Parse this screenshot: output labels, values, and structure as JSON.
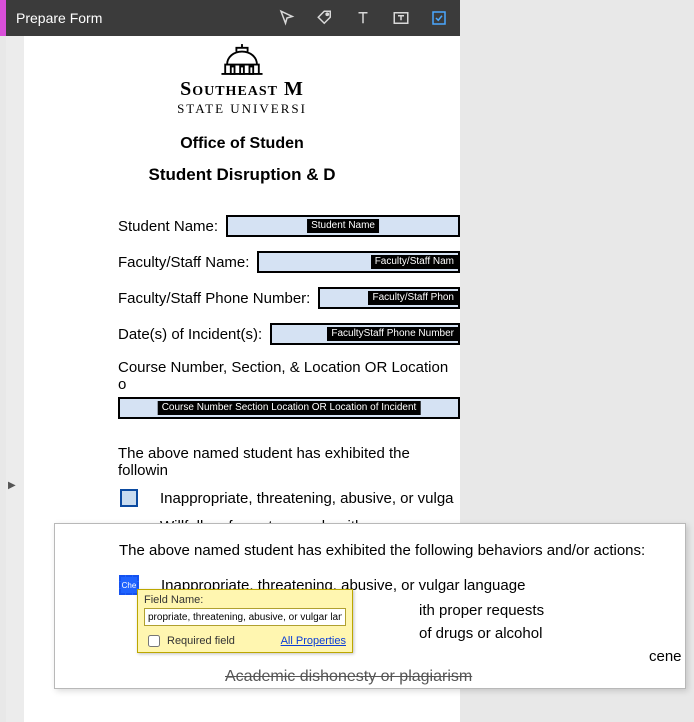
{
  "toolbar": {
    "title": "Prepare Form",
    "tools": {
      "pointer": "pointer-tool-icon",
      "tag": "tag-tool-icon",
      "text": "text-field-tool-icon",
      "textframe": "text-frame-tool-icon",
      "checkbox": "checkbox-tool-icon"
    }
  },
  "document": {
    "university_name": "Southeast M",
    "university_sub": "STATE UNIVERSI",
    "office_line": "Office of Studen",
    "form_title": "Student Disruption & D",
    "fields": {
      "student_name": {
        "label": "Student Name:",
        "tag": "Student Name"
      },
      "faculty_name": {
        "label": "Faculty/Staff Name:",
        "tag": "Faculty/Staff Nam"
      },
      "faculty_phone": {
        "label": "Faculty/Staff Phone Number:",
        "tag": "Faculty/Staff Phon"
      },
      "dates": {
        "label": "Date(s) of Incident(s):",
        "tag": "FacultyStaff Phone Number"
      },
      "course_loc": {
        "label": "Course Number, Section, & Location OR Location o",
        "tag": "Course Number Section  Location OR Location of Incident"
      }
    },
    "paragraph": "The above named student has exhibited the followin",
    "behaviors": [
      "Inappropriate, threatening, abusive, or vulga",
      "Willfully refuses to comply with proper reque"
    ]
  },
  "zoom": {
    "paragraph": "The above named student has exhibited the following behaviors and/or actions:",
    "behaviors": [
      "Inappropriate, threatening, abusive, or vulgar language",
      "ith proper requests",
      "of drugs or alcohol",
      "cene conduct"
    ],
    "chk_badge": "Che",
    "struck": "Academic dishonesty or plagiarism"
  },
  "field_name_popup": {
    "title": "Field Name:",
    "value": "propriate, threatening, abusive, or vulgar language",
    "required_label": "Required field",
    "all_properties": "All Properties"
  }
}
